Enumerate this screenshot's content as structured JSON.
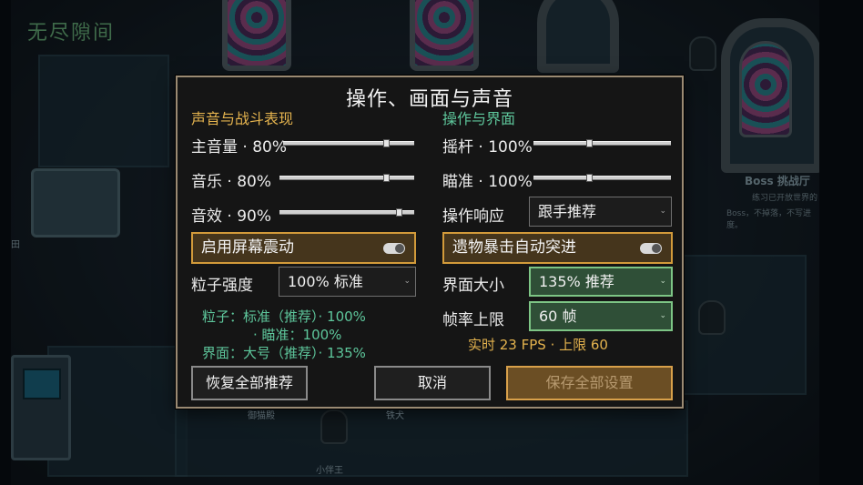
{
  "scene": {
    "title": "无尽隙间",
    "labels": {
      "boss_title": "Boss 挑战厅",
      "boss_sub1": "练习已开放世界的",
      "boss_sub2": "Boss，不掉落，不写进度。",
      "left_edge": "田",
      "npc_bottom": "小伴王",
      "bottom_a": "御猫殿",
      "bottom_b": "铁犬"
    }
  },
  "dialog": {
    "title": "操作、画面与声音",
    "sections": {
      "left": "声音与战斗表现",
      "right": "操作与界面"
    },
    "sliders": [
      {
        "label": "主音量 · 80%",
        "value": 0.8
      },
      {
        "label": "音乐 · 80%",
        "value": 0.8
      },
      {
        "label": "音效 · 90%",
        "value": 0.9
      },
      {
        "label": "摇杆 · 100%",
        "value": 0.4
      },
      {
        "label": "瞄准 · 100%",
        "value": 0.4
      }
    ],
    "response": {
      "label": "操作响应",
      "value": "跟手推荐"
    },
    "toggles": {
      "screen_shake": {
        "label": "启用屏幕震动",
        "on": true
      },
      "relic_crit": {
        "label": "遗物暴击自动突进",
        "on": true
      }
    },
    "particle": {
      "label": "粒子强度",
      "value": "100% 标准"
    },
    "ui_size": {
      "label": "界面大小",
      "value": "135% 推荐"
    },
    "fps_cap": {
      "label": "帧率上限",
      "value": "60 帧"
    },
    "info": {
      "line1": "粒子：标准（推荐）· 100%",
      "line2": "· 瞄准：100%",
      "line3": "界面：大号（推荐）· 135%"
    },
    "fps_status": "实时 23 FPS · 上限 60",
    "buttons": {
      "restore": "恢复全部推荐",
      "cancel": "取消",
      "save": "保存全部设置"
    },
    "icons": {
      "chevron": "chevron-down-icon"
    },
    "colors": {
      "accent_gold": "#e4b34e",
      "accent_green": "#5ec79c",
      "toggle_border": "#d29a3a",
      "selected_green": "#2f4f37"
    }
  }
}
